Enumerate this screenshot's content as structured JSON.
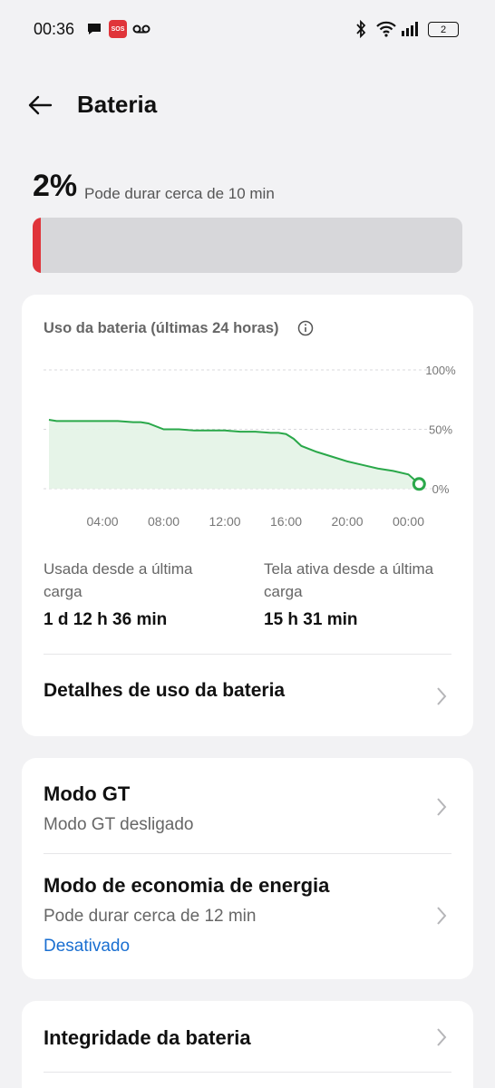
{
  "status_bar": {
    "time": "00:36",
    "sos_label": "SOS",
    "battery_level": "2",
    "icons": [
      "chat-bubble-icon",
      "sos-icon",
      "voicemail-icon",
      "bluetooth-icon",
      "wifi-icon",
      "signal-icon",
      "battery-icon"
    ]
  },
  "header": {
    "title": "Bateria"
  },
  "battery": {
    "percent": "2%",
    "estimate": "Pode durar cerca de 10 min",
    "level_fraction": 0.02,
    "level_color": "#e0343a"
  },
  "usage_card": {
    "title": "Uso da bateria (últimas 24 horas)",
    "used_since_label": "Usada desde a última carga",
    "used_since_value": "1 d 12 h 36 min",
    "screen_on_label": "Tela ativa desde a última carga",
    "screen_on_value": "15 h 31 min",
    "details_label": "Detalhes de uso da bateria"
  },
  "modes_card": {
    "gt_title": "Modo GT",
    "gt_status": "Modo GT desligado",
    "saver_title": "Modo de economia de energia",
    "saver_estimate": "Pode durar cerca de 12 min",
    "saver_status": "Desativado"
  },
  "health_card": {
    "title": "Integridade da bateria"
  },
  "chart_data": {
    "type": "area",
    "title": "Uso da bateria (últimas 24 horas)",
    "xlabel": "",
    "ylabel": "",
    "x_ticks": [
      "04:00",
      "08:00",
      "12:00",
      "16:00",
      "20:00",
      "00:00"
    ],
    "y_ticks": [
      "100%",
      "50%",
      "0%"
    ],
    "ylim": [
      0,
      100
    ],
    "xlim": [
      0.5,
      24.8
    ],
    "grid": true,
    "line_color": "#2aa84a",
    "fill_color": "#e3f3e6",
    "series": [
      {
        "x": [
          0.5,
          1.0,
          2.0,
          3.0,
          4.0,
          5.0,
          6.0,
          6.5,
          7.0,
          8.0,
          9.0,
          10.0,
          11.0,
          12.0,
          13.0,
          14.0,
          15.0,
          15.5,
          16.0,
          16.5,
          17.0,
          18.0,
          19.0,
          20.0,
          21.0,
          22.0,
          23.0,
          24.0,
          24.7
        ],
        "y": [
          58,
          57,
          57,
          57,
          57,
          57,
          56,
          56,
          55,
          50,
          50,
          49,
          49,
          49,
          48,
          48,
          47,
          47,
          46,
          42,
          36,
          31,
          27,
          23,
          20,
          17,
          15,
          12,
          4
        ]
      }
    ]
  }
}
